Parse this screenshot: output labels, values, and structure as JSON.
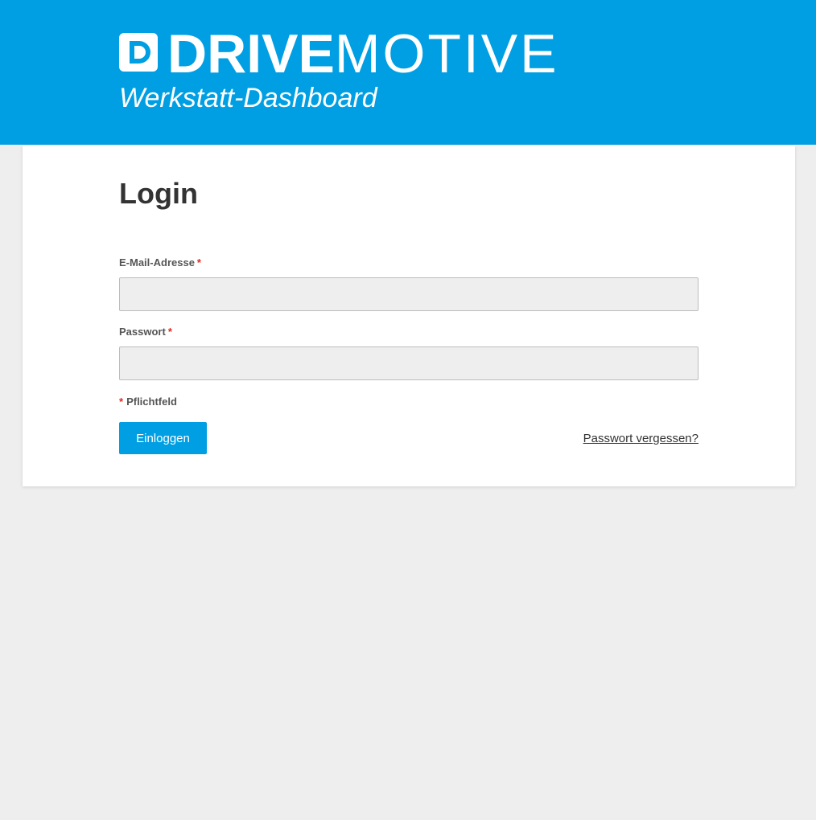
{
  "header": {
    "logo_icon": "drivemotive-d-logo-icon",
    "brand_bold": "DRIVE",
    "brand_light": "MOTIVE",
    "subtitle": "Werkstatt-Dashboard",
    "background_color": "#009fe3"
  },
  "login": {
    "title": "Login",
    "email": {
      "label": "E-Mail-Adresse",
      "required_marker": "*",
      "value": ""
    },
    "password": {
      "label": "Passwort",
      "required_marker": "*",
      "value": ""
    },
    "required_note_marker": "*",
    "required_note": "Pflichtfeld",
    "submit_label": "Einloggen",
    "forgot_password_label": "Passwort vergessen?"
  },
  "colors": {
    "accent": "#009fe3",
    "required": "#e2281e",
    "page_background": "#eeeeee"
  }
}
